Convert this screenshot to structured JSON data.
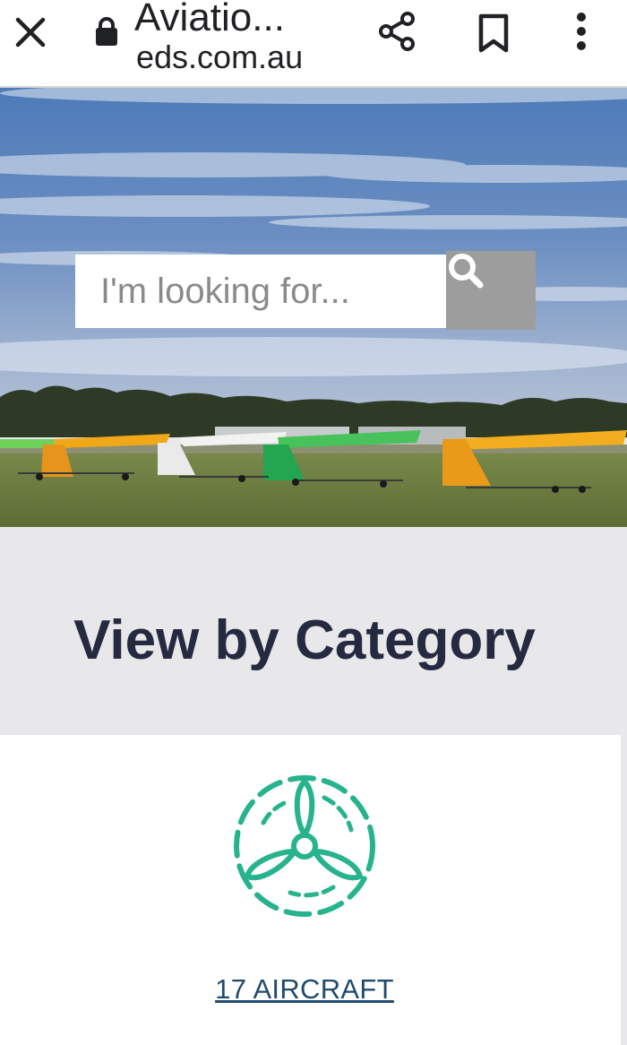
{
  "browser": {
    "title": "Aviatio...",
    "url": "ieds.com.au",
    "icons": {
      "close": "close-icon",
      "lock": "lock-icon",
      "share": "share-icon",
      "bookmark": "bookmark-icon",
      "menu": "more-vert-icon"
    }
  },
  "hero": {
    "search_placeholder": "I'm looking for...",
    "search_icon": "search-icon"
  },
  "categories": {
    "heading": "View by Category",
    "items": [
      {
        "label": "17 AIRCRAFT",
        "icon": "propeller-icon"
      }
    ]
  },
  "colors": {
    "accent": "#26b38e",
    "heading": "#262a40",
    "link": "#1f4b6e",
    "search_button": "#9d9d9d",
    "section_bg": "#e8e8ea"
  }
}
